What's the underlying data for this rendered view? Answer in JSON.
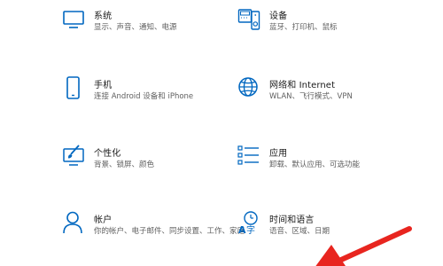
{
  "colors": {
    "accent": "#0067c0",
    "title_text": "#1a1a1a",
    "desc_text": "#5f5f5f",
    "annotation_arrow": "#e8251f"
  },
  "settings": [
    {
      "icon": "monitor-icon",
      "title": "系统",
      "desc": "显示、声音、通知、电源"
    },
    {
      "icon": "devices-icon",
      "title": "设备",
      "desc": "蓝牙、打印机、鼠标"
    },
    {
      "icon": "phone-icon",
      "title": "手机",
      "desc": "连接 Android 设备和 iPhone"
    },
    {
      "icon": "globe-icon",
      "title": "网络和 Internet",
      "desc": "WLAN、飞行模式、VPN"
    },
    {
      "icon": "personalization-icon",
      "title": "个性化",
      "desc": "背景、锁屏、颜色"
    },
    {
      "icon": "apps-icon",
      "title": "应用",
      "desc": "卸载、默认应用、可选功能"
    },
    {
      "icon": "person-icon",
      "title": "帐户",
      "desc": "你的帐户、电子邮件、同步设置、工作、家庭"
    },
    {
      "icon": "time-language-icon",
      "title": "时间和语言",
      "desc": "语音、区域、日期"
    }
  ]
}
